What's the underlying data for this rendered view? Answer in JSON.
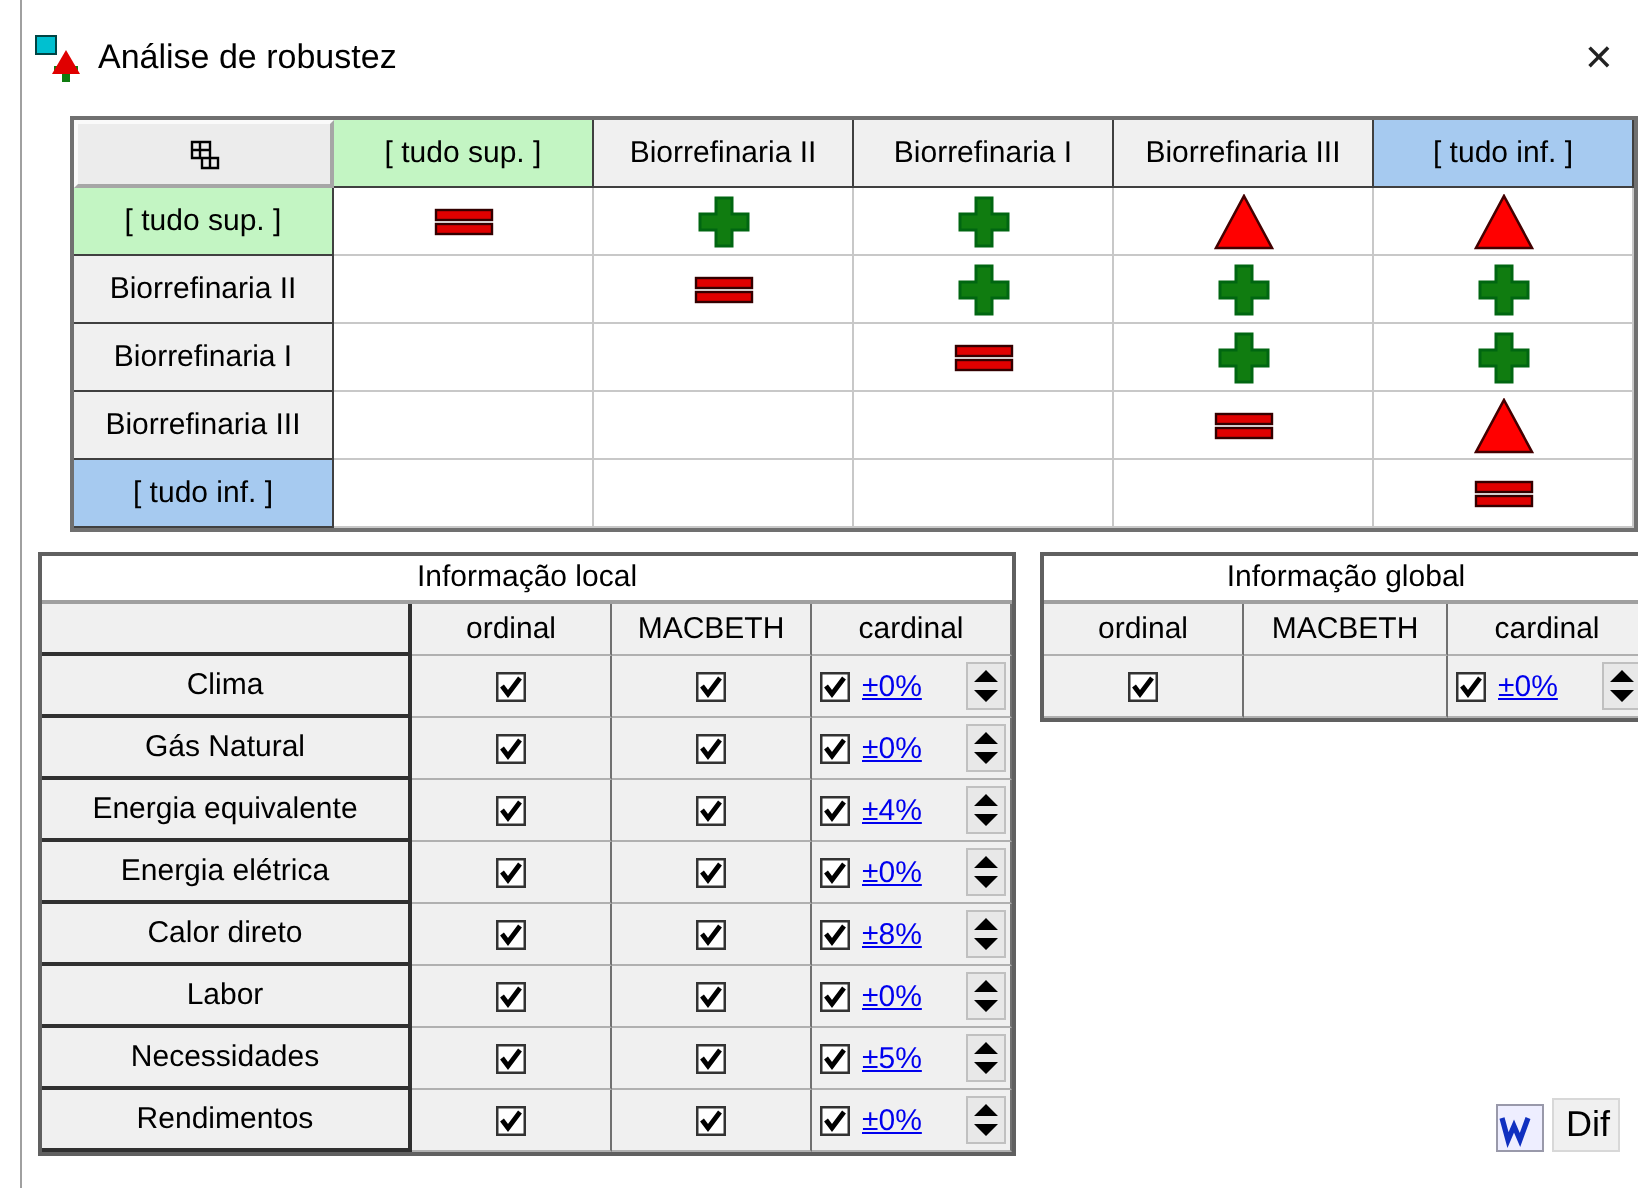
{
  "window": {
    "title": "Análise de robustez",
    "close": "✕"
  },
  "matrix": {
    "columns": [
      {
        "label": "[ tudo sup. ]",
        "color": "#c3f5c3"
      },
      {
        "label": "Biorrefinaria II",
        "color": "#f0f0f0"
      },
      {
        "label": "Biorrefinaria I",
        "color": "#f0f0f0"
      },
      {
        "label": "Biorrefinaria III",
        "color": "#f0f0f0"
      },
      {
        "label": "[ tudo inf. ]",
        "color": "#a6caf0"
      }
    ],
    "rows": [
      {
        "label": "[ tudo sup. ]",
        "color": "#c3f5c3",
        "cells": [
          {
            "kind": "equal"
          },
          {
            "kind": "plus"
          },
          {
            "kind": "plus"
          },
          {
            "kind": "triangle"
          },
          {
            "kind": "triangle"
          }
        ]
      },
      {
        "label": "Biorrefinaria II",
        "color": "#f0f0f0",
        "cells": [
          {
            "kind": "blank"
          },
          {
            "kind": "equal"
          },
          {
            "kind": "plus"
          },
          {
            "kind": "plus"
          },
          {
            "kind": "plus"
          }
        ]
      },
      {
        "label": "Biorrefinaria I",
        "color": "#f0f0f0",
        "cells": [
          {
            "kind": "blank"
          },
          {
            "kind": "blank"
          },
          {
            "kind": "equal"
          },
          {
            "kind": "plus"
          },
          {
            "kind": "plus"
          }
        ]
      },
      {
        "label": "Biorrefinaria III",
        "color": "#f0f0f0",
        "cells": [
          {
            "kind": "blank"
          },
          {
            "kind": "blank"
          },
          {
            "kind": "blank"
          },
          {
            "kind": "equal"
          },
          {
            "kind": "triangle"
          }
        ]
      },
      {
        "label": "[ tudo inf. ]",
        "color": "#a6caf0",
        "cells": [
          {
            "kind": "blank"
          },
          {
            "kind": "blank"
          },
          {
            "kind": "blank"
          },
          {
            "kind": "blank"
          },
          {
            "kind": "equal"
          }
        ]
      }
    ]
  },
  "local_info": {
    "title": "Informação local",
    "columns": [
      "ordinal",
      "MACBETH",
      "cardinal"
    ],
    "rows": [
      {
        "label": "Clima",
        "ordinal_checked": true,
        "macbeth_checked": true,
        "cardinal_checked": true,
        "margin": "±0%"
      },
      {
        "label": "Gás Natural",
        "ordinal_checked": true,
        "macbeth_checked": true,
        "cardinal_checked": true,
        "margin": "±0%"
      },
      {
        "label": "Energia equivalente",
        "ordinal_checked": true,
        "macbeth_checked": true,
        "cardinal_checked": true,
        "margin": "±4%"
      },
      {
        "label": "Energia elétrica",
        "ordinal_checked": true,
        "macbeth_checked": true,
        "cardinal_checked": true,
        "margin": "±0%"
      },
      {
        "label": "Calor direto",
        "ordinal_checked": true,
        "macbeth_checked": true,
        "cardinal_checked": true,
        "margin": "±8%"
      },
      {
        "label": "Labor",
        "ordinal_checked": true,
        "macbeth_checked": true,
        "cardinal_checked": true,
        "margin": "±0%"
      },
      {
        "label": "Necessidades",
        "ordinal_checked": true,
        "macbeth_checked": true,
        "cardinal_checked": true,
        "margin": "±5%"
      },
      {
        "label": "Rendimentos",
        "ordinal_checked": true,
        "macbeth_checked": true,
        "cardinal_checked": true,
        "margin": "±0%"
      }
    ]
  },
  "global_info": {
    "title": "Informação global",
    "columns": [
      "ordinal",
      "MACBETH",
      "cardinal"
    ],
    "rows": [
      {
        "ordinal_checked": true,
        "cardinal_checked": true,
        "margin": "±0%"
      }
    ]
  },
  "footer": {
    "button_label": "Dif"
  }
}
